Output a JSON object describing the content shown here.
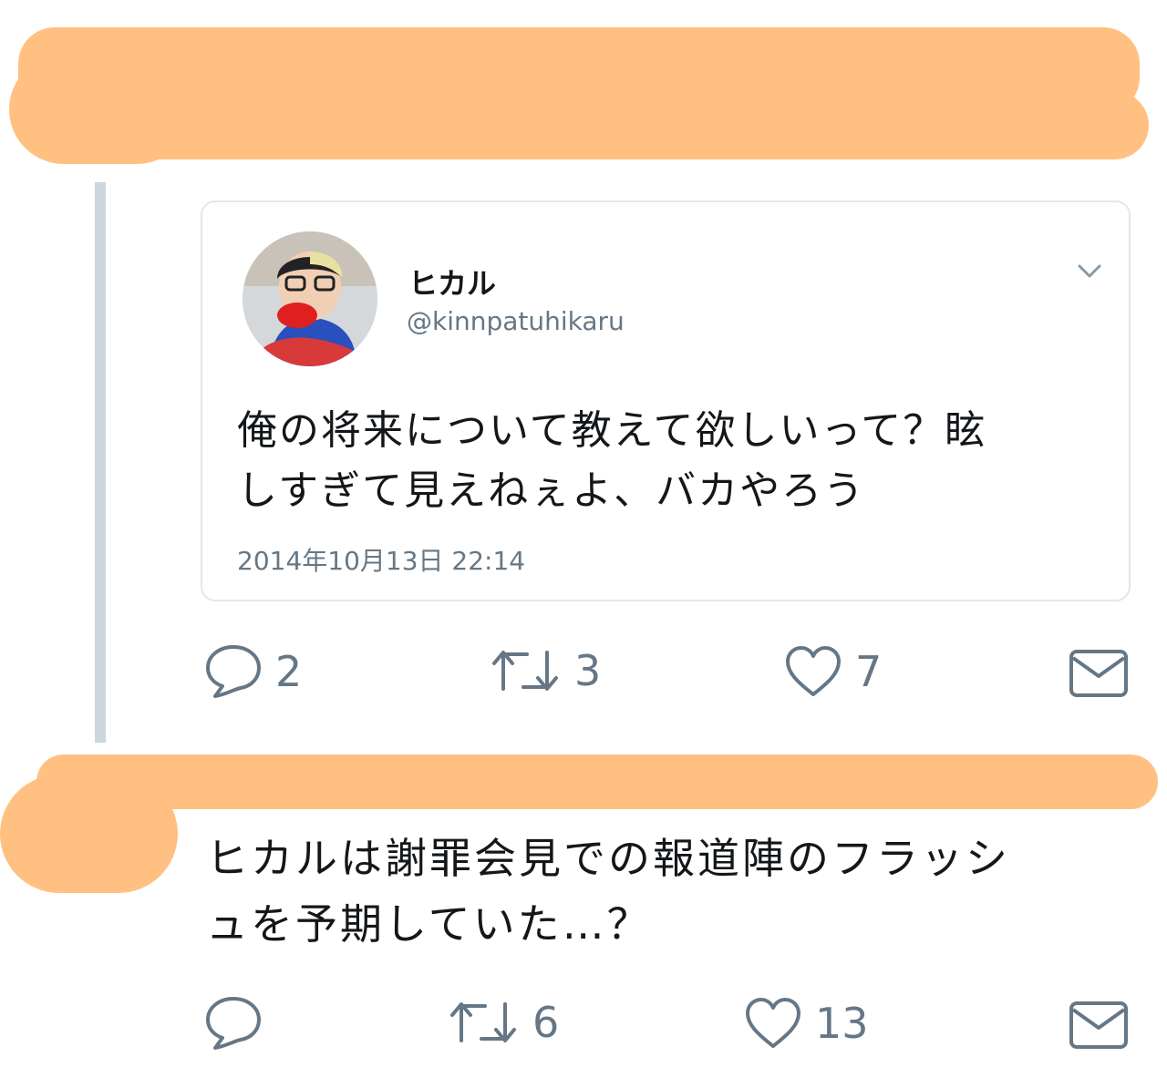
{
  "quoted_tweet": {
    "author_name": "ヒカル",
    "author_handle": "@kinnpatuhikaru",
    "text_line1": "俺の将来について教えて欲しいって？眩",
    "text_line2": "しすぎて見えねぇよ、バカやろう",
    "timestamp": "2014年10月13日 22:14"
  },
  "first_tweet_actions": {
    "replies": "2",
    "retweets": "3",
    "likes": "7"
  },
  "second_tweet": {
    "text_line1": "ヒカルは謝罪会見での報道陣のフラッシ",
    "text_line2": "ュを予期していた…？"
  },
  "second_tweet_actions": {
    "retweets": "6",
    "likes": "13"
  },
  "icons": [
    "chevron-down-icon",
    "reply-icon",
    "retweet-icon",
    "like-icon",
    "direct-message-icon"
  ],
  "colors": {
    "redaction": "#ffc082",
    "secondary_text": "#657786",
    "border": "#e1e8ed",
    "thread_line": "#ccd6dd"
  }
}
